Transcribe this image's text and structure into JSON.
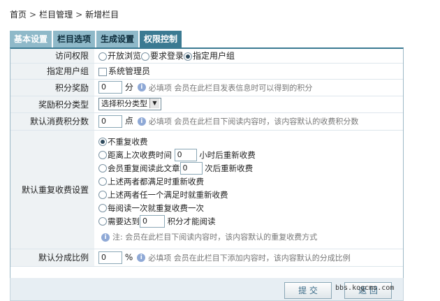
{
  "breadcrumb": {
    "home": "首页",
    "sep": ">",
    "section": "栏目管理",
    "current": "新增栏目"
  },
  "tabs": [
    {
      "label": "基本设置"
    },
    {
      "label": "栏目选项"
    },
    {
      "label": "生成设置"
    },
    {
      "label": "权限控制"
    }
  ],
  "access": {
    "label": "访问权限",
    "options": [
      "开放浏览",
      "要求登录",
      "指定用户组"
    ],
    "selected": "指定用户组"
  },
  "user_group": {
    "label": "指定用户组",
    "option": "系统管理员",
    "checked": false
  },
  "points_reward": {
    "label": "积分奖励",
    "value": "0",
    "unit": "分",
    "hint": "必填项  会员在此栏目发表信息时可以得到的积分"
  },
  "reward_type": {
    "label": "奖励积分类型",
    "selected": "选择积分类型"
  },
  "default_points": {
    "label": "默认消费积分数",
    "value": "0",
    "unit": "点",
    "hint": "必填项  会员在此栏目下阅读内容时，该内容默认的收费积分数"
  },
  "repeat_charge": {
    "label": "默认重复收费设置",
    "opt1": "不重复收费",
    "opt2_pre": "距离上次收费时间",
    "opt2_value": "0",
    "opt2_post": "小时后重新收费",
    "opt3_pre": "会员重复阅读此文章",
    "opt3_value": "0",
    "opt3_post": "次后重新收费",
    "opt4": "上述两者都满足时重新收费",
    "opt5": "上述两者任一个满足时就重新收费",
    "opt6": "每阅读一次就重复收费一次",
    "opt7_pre": "需要达到",
    "opt7_value": "0",
    "opt7_post": "积分才能阅读",
    "selected": "不重复收费",
    "note": "注:  会员在此栏目下阅读内容时，该内容默认的重复收费方式"
  },
  "share_ratio": {
    "label": "默认分成比例",
    "value": "0",
    "unit": "%",
    "hint": "必填项  会员在此栏目下添加内容时，该内容默认的分成比例"
  },
  "buttons": {
    "submit": "提 交",
    "back": "返 回"
  },
  "watermark": "bbs.kogcms.com"
}
